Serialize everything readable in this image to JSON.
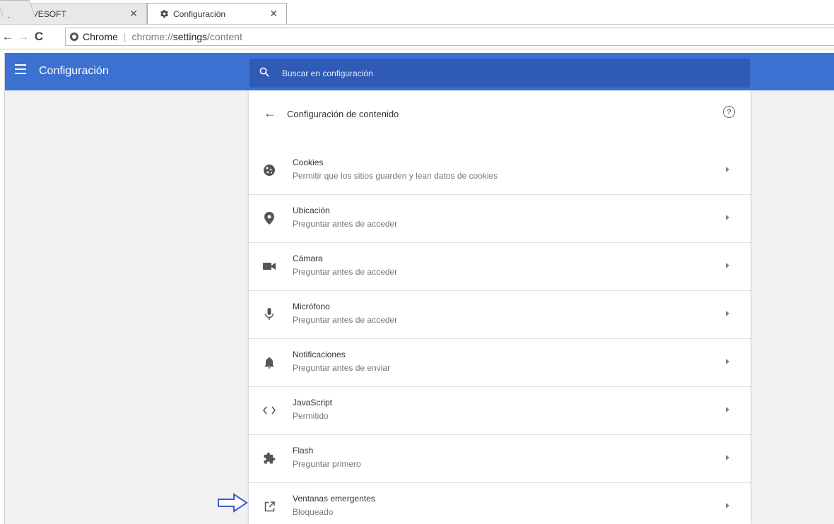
{
  "tabs": [
    {
      "label": "NAVESOFT",
      "icon": "navesoft-logo-icon"
    },
    {
      "label": "Configuración",
      "icon": "gear-icon"
    }
  ],
  "omnibox": {
    "site_label": "Chrome",
    "url_scheme": "chrome://",
    "url_bold": "settings",
    "url_rest": "/content"
  },
  "appbar": {
    "title": "Configuración",
    "search_placeholder": "Buscar en configuración"
  },
  "content": {
    "title": "Configuración de contenido",
    "items": [
      {
        "title": "Cookies",
        "subtitle": "Permitir que los sitios guarden y lean datos de cookies",
        "icon": "cookie-icon"
      },
      {
        "title": "Ubicación",
        "subtitle": "Preguntar antes de acceder",
        "icon": "location-pin-icon"
      },
      {
        "title": "Cámara",
        "subtitle": "Preguntar antes de acceder",
        "icon": "camera-icon"
      },
      {
        "title": "Micrófono",
        "subtitle": "Preguntar antes de acceder",
        "icon": "microphone-icon"
      },
      {
        "title": "Notificaciones",
        "subtitle": "Preguntar antes de enviar",
        "icon": "bell-icon"
      },
      {
        "title": "JavaScript",
        "subtitle": "Permitido",
        "icon": "code-icon"
      },
      {
        "title": "Flash",
        "subtitle": "Preguntar primero",
        "icon": "puzzle-icon"
      },
      {
        "title": "Ventanas emergentes",
        "subtitle": "Bloqueado",
        "icon": "open-in-new-icon"
      }
    ]
  },
  "colors": {
    "appbar": "#3d71d1",
    "searchbox": "#2f5ab5",
    "callout_arrow": "#3d5bd6"
  }
}
